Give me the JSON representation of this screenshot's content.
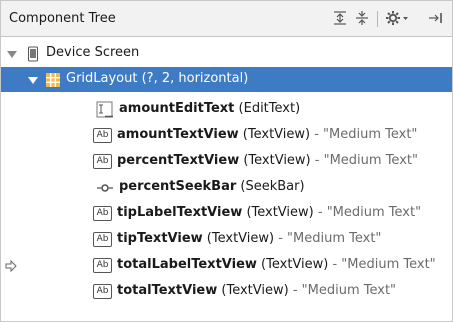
{
  "header": {
    "title": "Component Tree"
  },
  "tree": {
    "device": {
      "label": "Device Screen"
    },
    "layout": {
      "label": "GridLayout (?, 2, horizontal)"
    },
    "items": [
      {
        "name": "amountEditText",
        "type": "(EditText)",
        "value": "",
        "icon": "edittext-icon"
      },
      {
        "name": "amountTextView",
        "type": "(TextView)",
        "value": " - \"Medium Text\"",
        "icon": "textview-icon"
      },
      {
        "name": "percentTextView",
        "type": "(TextView)",
        "value": " - \"Medium Text\"",
        "icon": "textview-icon"
      },
      {
        "name": "percentSeekBar",
        "type": "(SeekBar)",
        "value": "",
        "icon": "seekbar-icon"
      },
      {
        "name": "tipLabelTextView",
        "type": "(TextView)",
        "value": " - \"Medium Text\"",
        "icon": "textview-icon"
      },
      {
        "name": "tipTextView",
        "type": "(TextView)",
        "value": " - \"Medium Text\"",
        "icon": "textview-icon"
      },
      {
        "name": "totalLabelTextView",
        "type": "(TextView)",
        "value": " - \"Medium Text\"",
        "icon": "textview-icon"
      },
      {
        "name": "totalTextView",
        "type": "(TextView)",
        "value": " - \"Medium Text\"",
        "icon": "textview-icon"
      }
    ],
    "ab_text": "Ab"
  },
  "colors": {
    "selection": "#3e7bc5",
    "header_bg": "#f2f2f2"
  }
}
